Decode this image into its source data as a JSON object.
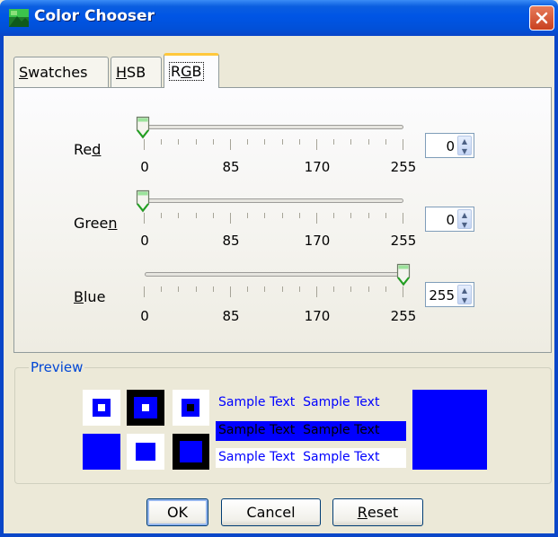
{
  "window": {
    "title": "Color Chooser"
  },
  "tabs": [
    {
      "label": "Swatches",
      "mnemonic": "S",
      "rest": "watches"
    },
    {
      "label": "HSB",
      "mnemonic": "H",
      "rest": "SB"
    },
    {
      "label": "RGB",
      "pre": "R",
      "mnemonic": "G",
      "rest": "B",
      "active": true
    }
  ],
  "sliders": [
    {
      "name": "red",
      "label_pre": "Re",
      "label_mn": "d",
      "label_post": "",
      "value": "0",
      "ticks": [
        "0",
        "85",
        "170",
        "255"
      ]
    },
    {
      "name": "green",
      "label_pre": "Gree",
      "label_mn": "n",
      "label_post": "",
      "value": "0",
      "ticks": [
        "0",
        "85",
        "170",
        "255"
      ]
    },
    {
      "name": "blue",
      "label_pre": "",
      "label_mn": "B",
      "label_post": "lue",
      "value": "255",
      "ticks": [
        "0",
        "85",
        "170",
        "255"
      ]
    }
  ],
  "preview": {
    "title": "Preview",
    "sample_text": "Sample Text",
    "color": "#0000ff"
  },
  "buttons": {
    "ok": "OK",
    "cancel": "Cancel",
    "reset_mn": "R",
    "reset_rest": "eset"
  }
}
